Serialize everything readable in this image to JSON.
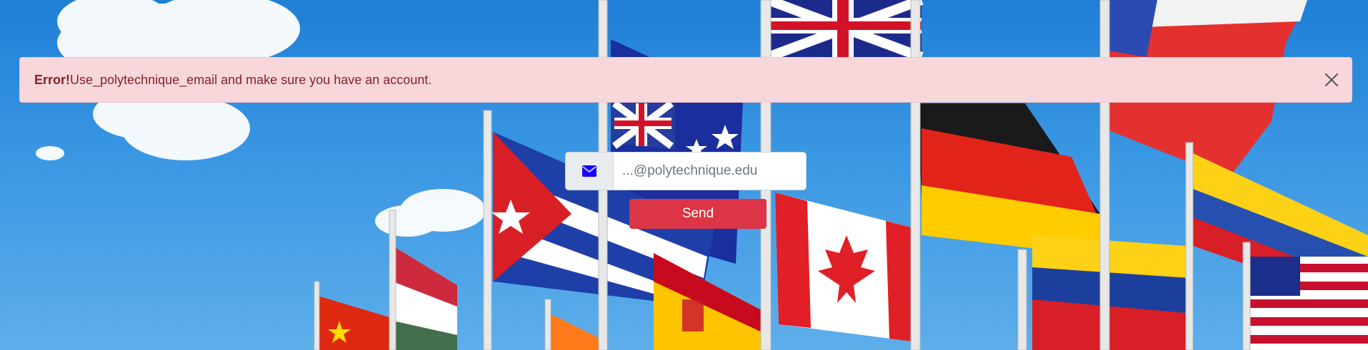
{
  "alert": {
    "title": "Error!",
    "message": "Use_polytechnique_email and make sure you have an account.",
    "close_label": "Close"
  },
  "form": {
    "email_placeholder": "...@polytechnique.edu",
    "email_value": "",
    "email_icon": "envelope-icon",
    "send_label": "Send"
  },
  "background": {
    "description_icon": "world-flags-scene"
  },
  "colors": {
    "alert_bg": "#f8d7da",
    "alert_text": "#842029",
    "button_bg": "#dc3545",
    "envelope": "#1a00ff"
  }
}
